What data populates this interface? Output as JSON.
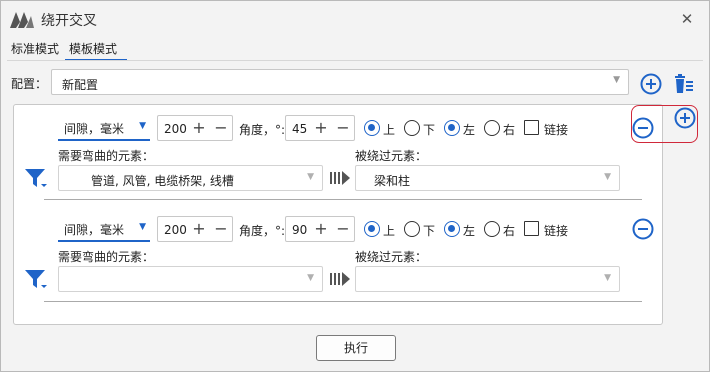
{
  "window": {
    "title": "绕开交叉",
    "close_symbol": "✕"
  },
  "tabs": [
    {
      "label": "标准模式"
    },
    {
      "label": "模板模式"
    }
  ],
  "config": {
    "label": "配置：",
    "value": "新配置"
  },
  "rows": [
    {
      "unit": "间隙，毫米",
      "gap": "200",
      "angle_label": "角度，°:",
      "angle": "45",
      "radios": [
        {
          "label": "上",
          "checked": true
        },
        {
          "label": "下",
          "checked": false
        },
        {
          "label": "左",
          "checked": true
        },
        {
          "label": "右",
          "checked": false
        }
      ],
      "link_label": "链接",
      "bend_label": "需要弯曲的元素：",
      "bend_value": "管道, 风管, 电缆桥架, 线槽",
      "bypass_label": "被绕过元素：",
      "bypass_value": "梁和柱"
    },
    {
      "unit": "间隙，毫米",
      "gap": "200",
      "angle_label": "角度，°:",
      "angle": "90",
      "radios": [
        {
          "label": "上",
          "checked": true
        },
        {
          "label": "下",
          "checked": false
        },
        {
          "label": "左",
          "checked": true
        },
        {
          "label": "右",
          "checked": false
        }
      ],
      "link_label": "链接",
      "bend_label": "需要弯曲的元素：",
      "bend_value": "",
      "bypass_label": "被绕过元素：",
      "bypass_value": ""
    }
  ],
  "execute_label": "执行",
  "colors": {
    "accent": "#1f64c8",
    "highlight": "#d0283a"
  }
}
